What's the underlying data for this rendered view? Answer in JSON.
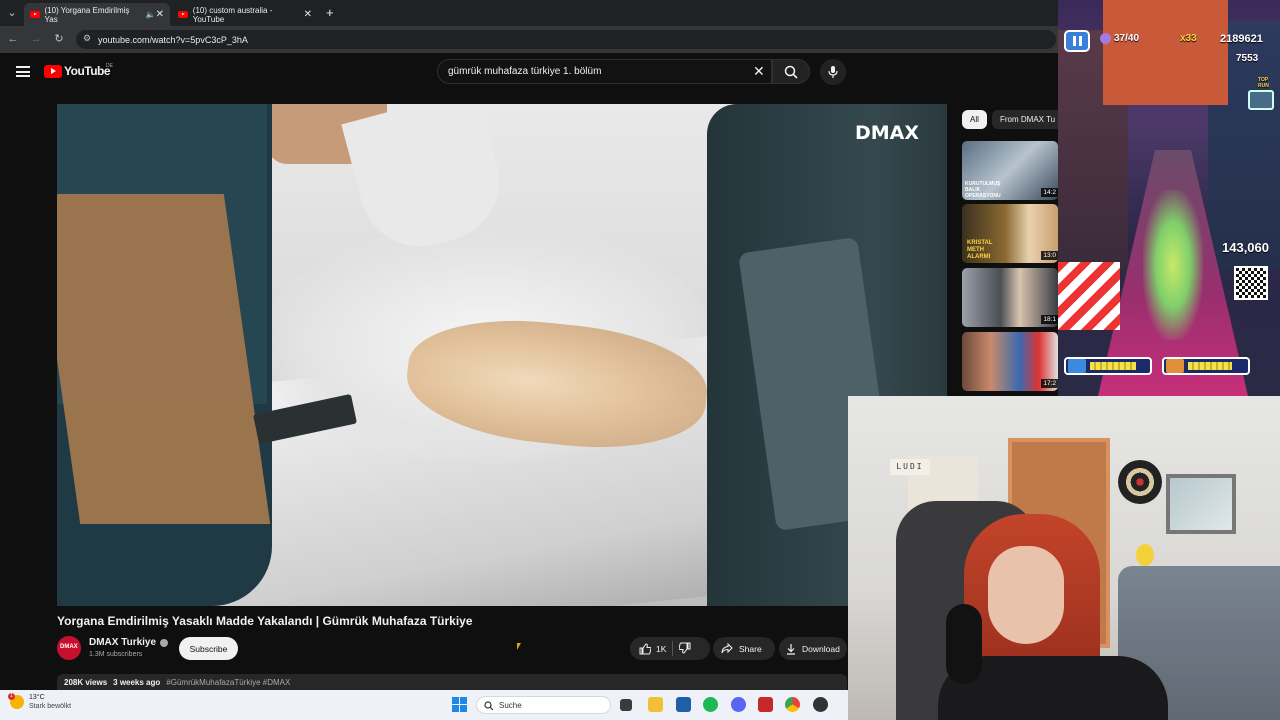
{
  "browser": {
    "tabs": [
      {
        "title": "(10) Yorgana Emdirilmiş Yas",
        "active": true
      },
      {
        "title": "(10) custom australia - YouTube",
        "active": false
      }
    ],
    "new_tab": "+",
    "url": "youtube.com/watch?v=5pvC3cP_3hA"
  },
  "youtube": {
    "logo": "YouTube",
    "region": "DE",
    "search_query": "gümrük muhafaza türkiye 1. bölüm",
    "video": {
      "watermark": "DMAX",
      "title": "Yorgana Emdirilmiş Yasaklı Madde Yakalandı | Gümrük Muhafaza Türkiye",
      "channel": "DMAX Turkiye",
      "channel_avatar_text": "DMAX",
      "subscribers": "1.3M subscribers",
      "subscribe_label": "Subscribe",
      "likes": "1K",
      "share_label": "Share",
      "download_label": "Download",
      "views": "208K views",
      "age": "3 weeks ago",
      "hashtags": "#GümrükMuhafazaTürkiye #DMAX"
    },
    "chips": [
      "All",
      "From DMAX Tu"
    ],
    "recommendations": [
      {
        "label": "KURUTULMUŞ BALIK OPERASYONU",
        "duration": "14:2"
      },
      {
        "label": "KRISTAL METH ALARMI",
        "duration": "13:0"
      },
      {
        "label": "",
        "duration": "18:1"
      },
      {
        "label": "",
        "duration": "17:2"
      }
    ]
  },
  "game": {
    "tokens": "37/40",
    "multiplier": "x33",
    "score": "2189621",
    "coins": "7553",
    "top_runs": "TOP RUN",
    "next_score": "143,060",
    "power_level_left": 0.8,
    "power_level_right": 0.75
  },
  "webcam": {
    "sign_text": "LUDI"
  },
  "taskbar": {
    "temperature": "13°C",
    "condition": "Stark bewölkt",
    "notification_count": "1",
    "search_placeholder": "Suche"
  },
  "colors": {
    "youtube_red": "#ff0000",
    "background": "#0f0f0f",
    "chip_active": "#f1f1f1"
  }
}
